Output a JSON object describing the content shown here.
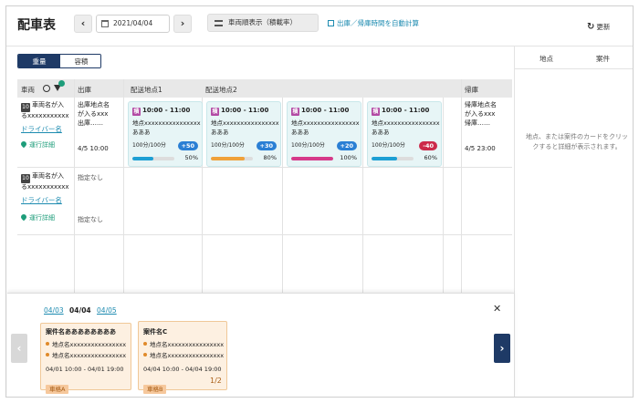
{
  "header": {
    "title": "配車表",
    "date": "2021/04/04",
    "view_toggle": "車両順表示（積載率）",
    "auto_calc": "出庫／帰庫時間を自動計算",
    "refresh": "更新"
  },
  "toggle": {
    "weight": "重量",
    "volume": "容積"
  },
  "right_panel": {
    "col_place": "地点",
    "col_case": "案件",
    "message": "地点、または案件のカードをクリックすると詳細が表示されます。"
  },
  "grid": {
    "headers": {
      "vehicle": "車両",
      "depart": "出庫",
      "stop1": "配送地点1",
      "stop2": "配送地点2",
      "return": "帰庫"
    },
    "rows": [
      {
        "vehicle_badge": "10",
        "vehicle_name_1": "車両名が入",
        "vehicle_name_2": "るxxxxxxxxxxx",
        "driver": "ドライバー名",
        "detail": "運行詳細",
        "depart_place": [
          "出庫地点名",
          "が入るxxx",
          "出庫……"
        ],
        "depart_time": "4/5 10:00",
        "return_place": [
          "帰庫地点名",
          "が入るxxx",
          "帰庫……"
        ],
        "return_time": "4/5 23:00",
        "stops": [
          {
            "badge": "積",
            "time": "10:00 - 11:00",
            "place_1": "地点xxxxxxxxxxxxxxxx",
            "place_2": "あああ",
            "capacity": "100分/100分",
            "pill": "+50",
            "pill_color": "#2a7fd4",
            "bar_color": "#1d9fd4",
            "progress": 0.5,
            "pct": "50%"
          },
          {
            "badge": "積",
            "time": "10:00 - 11:00",
            "place_1": "地点xxxxxxxxxxxxxxxx",
            "place_2": "あああ",
            "capacity": "100分/100分",
            "pill": "+30",
            "pill_color": "#2a7fd4",
            "bar_color": "#f0a13a",
            "progress": 0.8,
            "pct": "80%"
          },
          {
            "badge": "積",
            "time": "10:00 - 11:00",
            "place_1": "地点xxxxxxxxxxxxxxxx",
            "place_2": "あああ",
            "capacity": "100分/100分",
            "pill": "+20",
            "pill_color": "#2a7fd4",
            "bar_color": "#d63a8a",
            "progress": 1.0,
            "pct": "100%"
          },
          {
            "badge": "積",
            "time": "10:00 - 11:00",
            "place_1": "地点xxxxxxxxxxxxxxxx",
            "place_2": "あああ",
            "capacity": "100分/100分",
            "pill": "-40",
            "pill_color": "#cc2a4a",
            "bar_color": "#1d9fd4",
            "progress": 0.6,
            "pct": "60%"
          }
        ]
      },
      {
        "vehicle_badge": "10",
        "vehicle_name_1": "車両名が入",
        "vehicle_name_2": "るxxxxxxxxxxx",
        "driver": "ドライバー名",
        "detail": "運行詳細",
        "depart_1": "指定なし",
        "depart_2": "指定なし"
      }
    ]
  },
  "bottom": {
    "dates": [
      "04/03",
      "04/04",
      "04/05"
    ],
    "cards": [
      {
        "title": "案件名ああああああああ",
        "place_1": "地点名xxxxxxxxxxxxxxxx",
        "place_2": "地点名xxxxxxxxxxxxxxxx",
        "time": "04/01 10:00 - 04/01 19:00",
        "tag": "車格A"
      },
      {
        "title": "案件名C",
        "place_1": "地点名xxxxxxxxxxxxxxxx",
        "place_2": "地点名xxxxxxxxxxxxxxxx",
        "time": "04/04 10:00 - 04/04 19:00",
        "tag": "車格B",
        "count": "1/2"
      }
    ]
  }
}
